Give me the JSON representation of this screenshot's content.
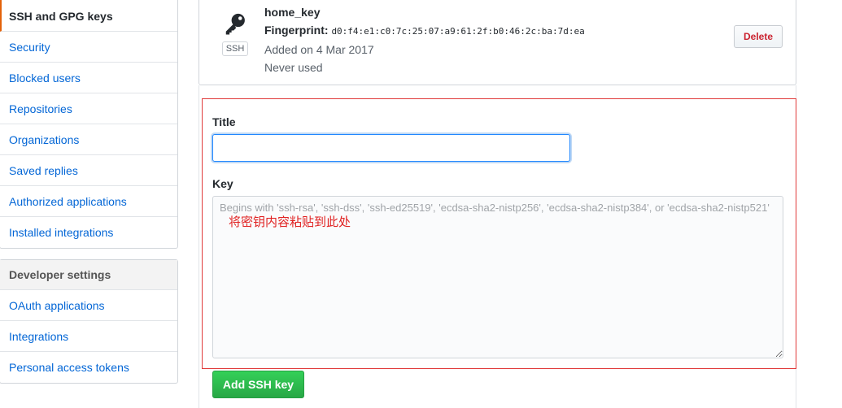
{
  "sidebar": {
    "account_items": [
      {
        "label": "SSH and GPG keys",
        "selected": true
      },
      {
        "label": "Security"
      },
      {
        "label": "Blocked users"
      },
      {
        "label": "Repositories"
      },
      {
        "label": "Organizations"
      },
      {
        "label": "Saved replies"
      },
      {
        "label": "Authorized applications"
      },
      {
        "label": "Installed integrations"
      }
    ],
    "developer_heading": "Developer settings",
    "developer_items": [
      {
        "label": "OAuth applications"
      },
      {
        "label": "Integrations"
      },
      {
        "label": "Personal access tokens"
      }
    ]
  },
  "ssh_key": {
    "icon": "key-icon",
    "type_label": "SSH",
    "title": "home_key",
    "fingerprint_label": "Fingerprint:",
    "fingerprint": "d0:f4:e1:c0:7c:25:07:a9:61:2f:b0:46:2c:ba:7d:ea",
    "added": "Added on 4 Mar 2017",
    "usage": "Never used",
    "delete_label": "Delete"
  },
  "form": {
    "title_label": "Title",
    "title_value": "",
    "key_label": "Key",
    "key_placeholder": "Begins with 'ssh-rsa', 'ssh-dss', 'ssh-ed25519', 'ecdsa-sha2-nistp256', 'ecdsa-sha2-nistp384', or 'ecdsa-sha2-nistp521'",
    "annotation": "将密钥内容粘贴到此处",
    "submit_label": "Add SSH key"
  },
  "colors": {
    "link": "#0366d6",
    "selected_border": "#e36209",
    "danger": "#cb2431",
    "annotation": "#e02020",
    "primary_button": "#28a745"
  }
}
